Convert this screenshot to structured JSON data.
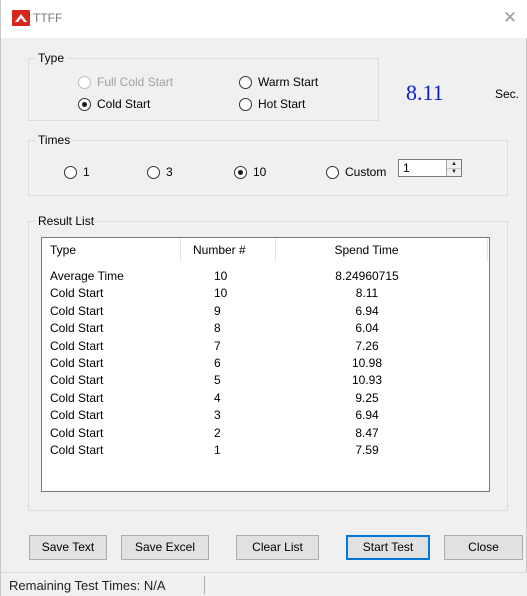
{
  "window": {
    "title": "TTFF"
  },
  "type_group": {
    "legend": "Type",
    "options": [
      {
        "label": "Full Cold Start",
        "checked": false,
        "disabled": true
      },
      {
        "label": "Warm Start",
        "checked": false,
        "disabled": false
      },
      {
        "label": "Cold Start",
        "checked": true,
        "disabled": false
      },
      {
        "label": "Hot Start",
        "checked": false,
        "disabled": false
      }
    ]
  },
  "result_value": "8.11",
  "result_unit": "Sec.",
  "times_group": {
    "legend": "Times",
    "options": [
      {
        "label": "1",
        "checked": false
      },
      {
        "label": "3",
        "checked": false
      },
      {
        "label": "10",
        "checked": true
      },
      {
        "label": "Custom",
        "checked": false
      }
    ],
    "custom_value": "1"
  },
  "result_list": {
    "legend": "Result List",
    "columns": [
      "Type",
      "Number #",
      "Spend Time"
    ],
    "rows": [
      [
        "Average Time",
        "10",
        "8.24960715"
      ],
      [
        "Cold Start",
        "10",
        "8.11"
      ],
      [
        "Cold Start",
        "9",
        "6.94"
      ],
      [
        "Cold Start",
        "8",
        "6.04"
      ],
      [
        "Cold Start",
        "7",
        "7.26"
      ],
      [
        "Cold Start",
        "6",
        "10.98"
      ],
      [
        "Cold Start",
        "5",
        "10.93"
      ],
      [
        "Cold Start",
        "4",
        "9.25"
      ],
      [
        "Cold Start",
        "3",
        "6.94"
      ],
      [
        "Cold Start",
        "2",
        "8.47"
      ],
      [
        "Cold Start",
        "1",
        "7.59"
      ]
    ]
  },
  "buttons": {
    "save_text": "Save Text",
    "save_excel": "Save Excel",
    "clear_list": "Clear List",
    "start_test": "Start Test",
    "close": "Close"
  },
  "status": {
    "text": "Remaining Test Times: N/A"
  },
  "colors": {
    "value_blue": "#0a1ec8",
    "accent": "#0078d7",
    "icon_red": "#d6261d"
  }
}
